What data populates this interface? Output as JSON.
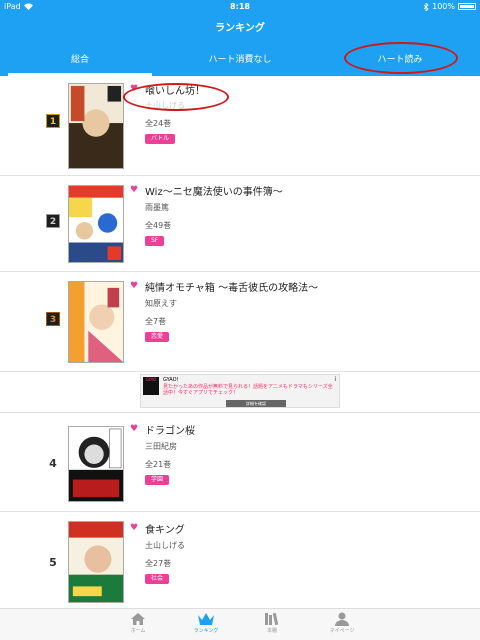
{
  "status": {
    "device": "iPad",
    "time": "8:18",
    "battery_pct": "100%"
  },
  "nav": {
    "title": "ランキング"
  },
  "tabs": [
    {
      "label": "総合",
      "active": true
    },
    {
      "label": "ハート消費なし",
      "active": false
    },
    {
      "label": "ハート読み",
      "active": false
    }
  ],
  "items": [
    {
      "rank": "1",
      "title": "喰いしん坊！",
      "author": "土山しげる",
      "volumes": "全24巻",
      "genre": "バトル",
      "cover_colors": [
        "#3a2a1a",
        "#c44a2a"
      ]
    },
    {
      "rank": "2",
      "title": "Wiz〜ニセ魔法使いの事件簿〜",
      "author": "雨墨篤",
      "volumes": "全49巻",
      "genre": "SF",
      "cover_colors": [
        "#e33a2a",
        "#2a6ad0"
      ]
    },
    {
      "rank": "3",
      "title": "純情オモチャ箱 〜毒舌彼氏の攻略法〜",
      "author": "知原えす",
      "volumes": "全7巻",
      "genre": "恋愛",
      "cover_colors": [
        "#f4a030",
        "#e06080"
      ]
    },
    {
      "rank": "4",
      "title": "ドラゴン桜",
      "author": "三田紀房",
      "volumes": "全21巻",
      "genre": "学園",
      "cover_colors": [
        "#111111",
        "#b81c1c"
      ]
    },
    {
      "rank": "5",
      "title": "食キング",
      "author": "土山しげる",
      "volumes": "全27巻",
      "genre": "社会",
      "cover_colors": [
        "#1c7a3a",
        "#d03020"
      ]
    }
  ],
  "ad": {
    "brand": "GYAO!",
    "text": "見たかったあの作品が無料で見られる！話題をアニメもドラマもシリーズ全話中！今すぐアプリでチェック！",
    "cta": "詳細を確認",
    "info": "i"
  },
  "bottom_tabs": [
    {
      "label": "ホーム",
      "icon": "home-icon",
      "active": false
    },
    {
      "label": "ランキング",
      "icon": "crown-icon",
      "active": true
    },
    {
      "label": "本棚",
      "icon": "bookshelf-icon",
      "active": false
    },
    {
      "label": "マイページ",
      "icon": "person-icon",
      "active": false
    }
  ],
  "colors": {
    "accent": "#1ea1f2",
    "genre": "#ec3f95",
    "highlight": "#d0181c"
  }
}
